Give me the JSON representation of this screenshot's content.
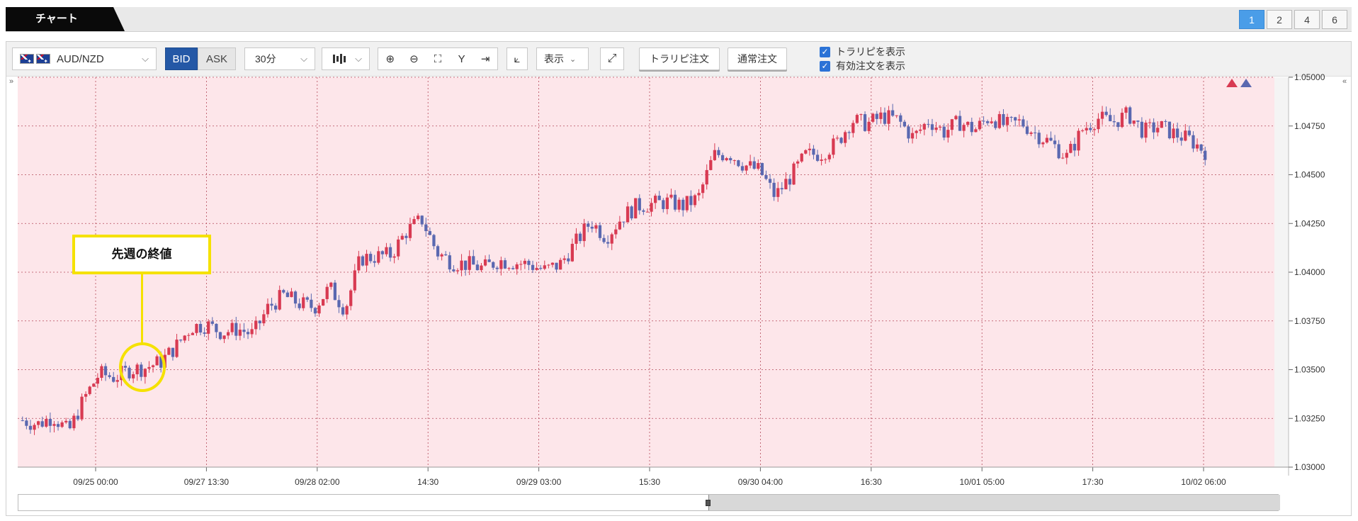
{
  "header": {
    "title": "チャート",
    "layouts": [
      "1",
      "2",
      "4",
      "6"
    ],
    "active_layout": "1"
  },
  "toolbar": {
    "pair": "AUD/NZD",
    "bid": "BID",
    "ask": "ASK",
    "interval": "30分",
    "display": "表示",
    "trail_order": "トラリピ注文",
    "normal_order": "通常注文",
    "show_trail": "トラリピを表示",
    "show_active": "有効注文を表示",
    "show_trail_checked": true,
    "show_active_checked": true
  },
  "annotation": {
    "label": "先週の終値"
  },
  "colors": {
    "up": "#d83a52",
    "down": "#5a68b0",
    "plot_bg": "#fde6ea",
    "accent": "#4a9de8"
  },
  "chart_data": {
    "type": "candlestick",
    "ylim": [
      1.03,
      1.05
    ],
    "y_ticks": [
      "1.05000",
      "1.04750",
      "1.04500",
      "1.04250",
      "1.04000",
      "1.03750",
      "1.03500",
      "1.03250",
      "1.03000"
    ],
    "x_ticks": [
      "09/25 00:00",
      "09/27 13:30",
      "09/28 02:00",
      "14:30",
      "09/29 03:00",
      "15:30",
      "09/30 04:00",
      "16:30",
      "10/01 05:00",
      "17:30",
      "10/02 06:00"
    ],
    "close_path": [
      1.0324,
      1.0322,
      1.0326,
      1.0318,
      1.0335,
      1.0348,
      1.0346,
      1.035,
      1.0351,
      1.0354,
      1.0362,
      1.0372,
      1.0373,
      1.0369,
      1.0371,
      1.0368,
      1.0382,
      1.0388,
      1.0384,
      1.0382,
      1.0392,
      1.0381,
      1.0407,
      1.0408,
      1.0409,
      1.0421,
      1.0427,
      1.041,
      1.0405,
      1.0404,
      1.0402,
      1.0406,
      1.0405,
      1.0404,
      1.0401,
      1.0404,
      1.0415,
      1.0426,
      1.0418,
      1.0428,
      1.0434,
      1.0435,
      1.0436,
      1.0434,
      1.0438,
      1.046,
      1.0461,
      1.0455,
      1.0452,
      1.0439,
      1.0449,
      1.046,
      1.0461,
      1.0466,
      1.0478,
      1.0476,
      1.048,
      1.0478,
      1.0469,
      1.0478,
      1.0472,
      1.0477,
      1.0473,
      1.048,
      1.0475,
      1.0477,
      1.0471,
      1.0466,
      1.0459,
      1.0473,
      1.0479,
      1.0477,
      1.0481,
      1.0472,
      1.0475,
      1.0471,
      1.0468,
      1.0462
    ]
  }
}
